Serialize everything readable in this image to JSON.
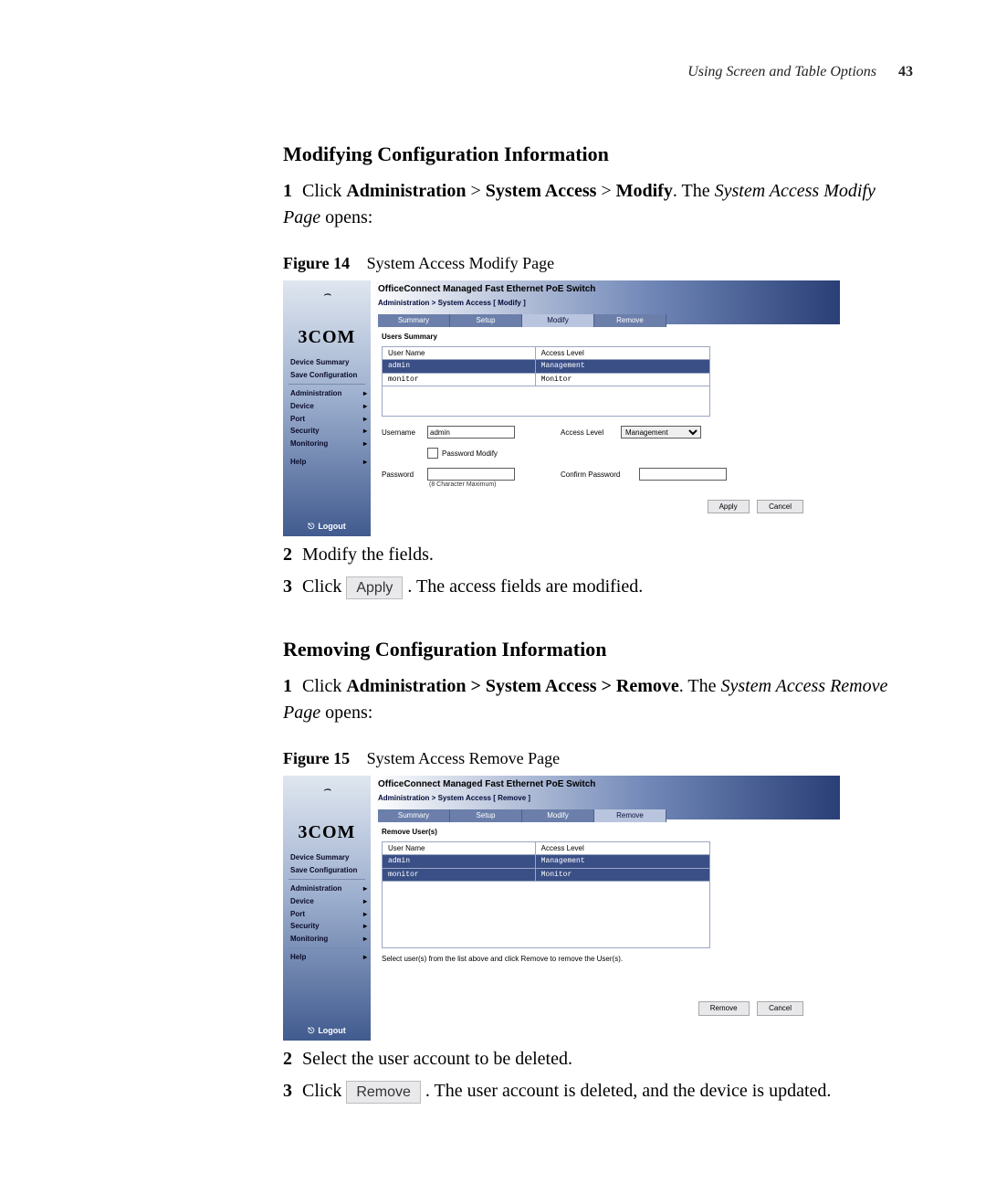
{
  "runhead": {
    "section": "Using Screen and Table Options",
    "page_no": "43"
  },
  "sec1": {
    "heading": "Modifying Configuration Information",
    "step1_a": "Click ",
    "b1": "Administration",
    "gt": " > ",
    "b2": "System Access",
    "b3": "Modify",
    "step1_b": ". The ",
    "it1": "System Access Modify Page",
    "step1_c": " opens:",
    "fig_label": "Figure 14",
    "fig_caption": "System Access Modify Page",
    "step2": "Modify the fields.",
    "step3_a": "Click ",
    "apply_btn": "Apply",
    "step3_b": ". The access fields are modified."
  },
  "sec2": {
    "heading": "Removing Configuration Information",
    "step1_a": "Click ",
    "b1": "Administration > System Access > Remove",
    "step1_b": ". The ",
    "it1": "System Access Remove Page",
    "step1_c": " opens:",
    "fig_label": "Figure 15",
    "fig_caption": "System Access Remove Page",
    "step2": "Select the user account to be deleted.",
    "step3_a": "Click ",
    "remove_btn": "Remove",
    "step3_b": ". The user account is deleted, and the device is updated."
  },
  "shot_common": {
    "product": "OfficeConnect Managed Fast Ethernet PoE Switch",
    "logo": "3COM",
    "sb_top": [
      "Device Summary",
      "Save Configuration"
    ],
    "sb_mid": [
      "Administration",
      "Device",
      "Port",
      "Security",
      "Monitoring"
    ],
    "sb_help": "Help",
    "logout": "Logout",
    "tabs": [
      "Summary",
      "Setup",
      "Modify",
      "Remove"
    ],
    "col_user": "User Name",
    "col_level": "Access Level",
    "users": [
      {
        "u": "admin",
        "l": "Management"
      },
      {
        "u": "monitor",
        "l": "Monitor"
      }
    ],
    "btn_apply": "Apply",
    "btn_cancel": "Cancel",
    "btn_remove": "Remove"
  },
  "shot1": {
    "bc": "Administration > System Access [ Modify ]",
    "panel_title": "Users Summary",
    "l_username": "Username",
    "v_username": "admin",
    "l_access": "Access Level",
    "v_access": "Management",
    "l_pwmod": "Password Modify",
    "l_password": "Password",
    "hint": "(8 Character Maximum)",
    "l_confirm": "Confirm Password"
  },
  "shot2": {
    "bc": "Administration > System Access [ Remove ]",
    "panel_title": "Remove User(s)",
    "note": "Select user(s) from the list above and click Remove to remove the User(s)."
  }
}
